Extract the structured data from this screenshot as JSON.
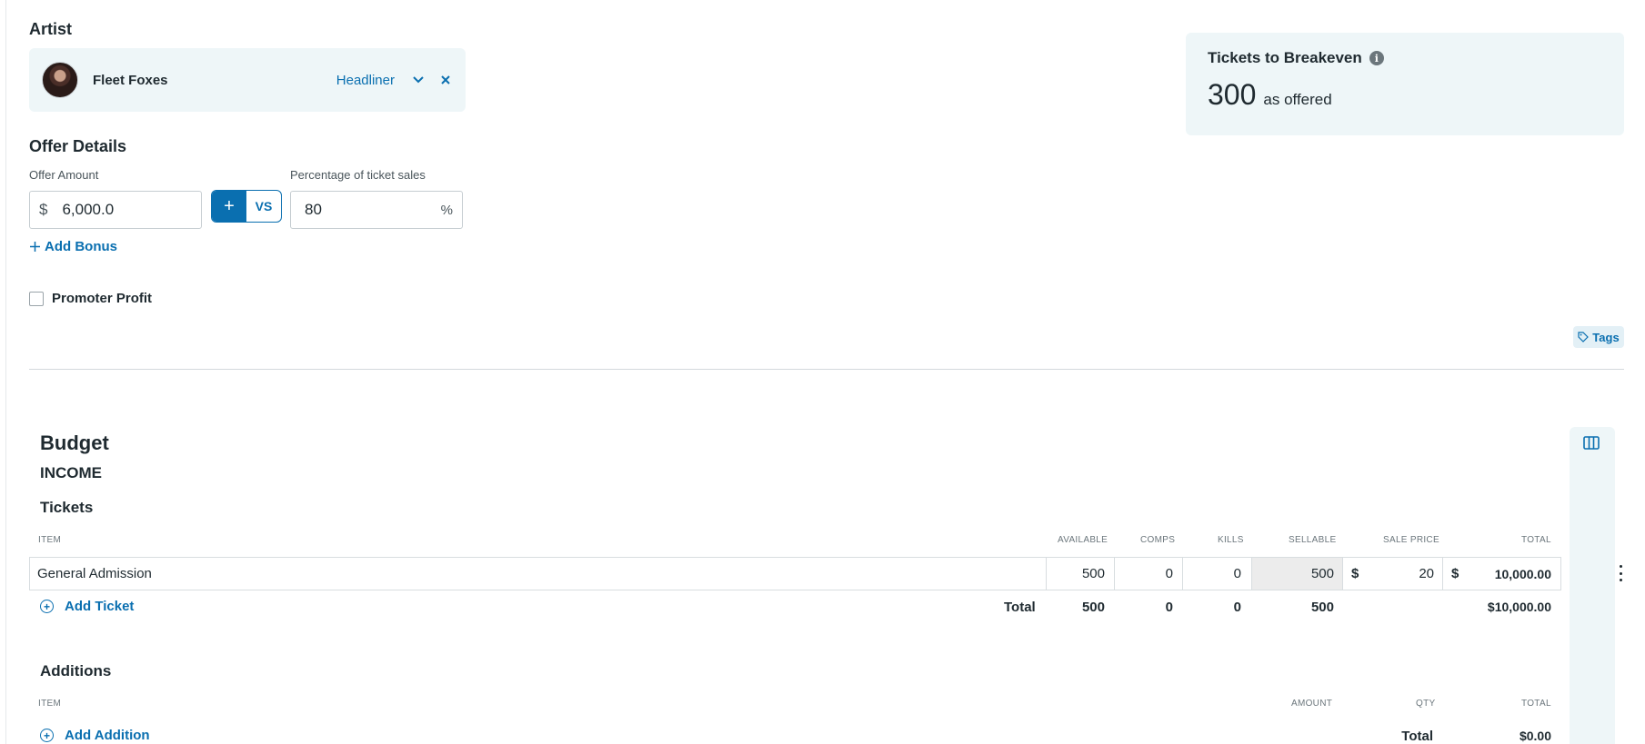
{
  "artist": {
    "section_title": "Artist",
    "name": "Fleet Foxes",
    "role": "Headliner"
  },
  "breakeven": {
    "title": "Tickets to Breakeven",
    "value": "300",
    "note": "as offered"
  },
  "offer": {
    "section_title": "Offer Details",
    "amount_label": "Offer Amount",
    "currency_symbol": "$",
    "amount_value": "6,000.0",
    "toggle_plus": "+",
    "toggle_vs": "VS",
    "percentage_label": "Percentage of ticket sales",
    "percentage_value": "80",
    "percent_sign": "%",
    "add_bonus": "Add Bonus",
    "promoter_profit": "Promoter Profit",
    "tags": "Tags"
  },
  "budget": {
    "title": "Budget",
    "income_label": "INCOME",
    "tickets": {
      "title": "Tickets",
      "columns": [
        "ITEM",
        "AVAILABLE",
        "COMPS",
        "KILLS",
        "SELLABLE",
        "SALE PRICE",
        "TOTAL"
      ],
      "rows": [
        {
          "item": "General Admission",
          "available": "500",
          "comps": "0",
          "kills": "0",
          "sellable": "500",
          "price_symbol": "$",
          "sale_price": "20",
          "total_symbol": "$",
          "total": "10,000.00"
        }
      ],
      "add_label": "Add Ticket",
      "totals": {
        "label": "Total",
        "available": "500",
        "comps": "0",
        "kills": "0",
        "sellable": "500",
        "total": "$10,000.00"
      }
    },
    "additions": {
      "title": "Additions",
      "columns": [
        "ITEM",
        "AMOUNT",
        "QTY",
        "TOTAL"
      ],
      "add_label": "Add Addition",
      "total_label": "Total",
      "total_value": "$0.00"
    }
  },
  "colors": {
    "accent": "#0a6fb0",
    "card_bg": "#eef6f8",
    "text": "#1f2a30"
  }
}
